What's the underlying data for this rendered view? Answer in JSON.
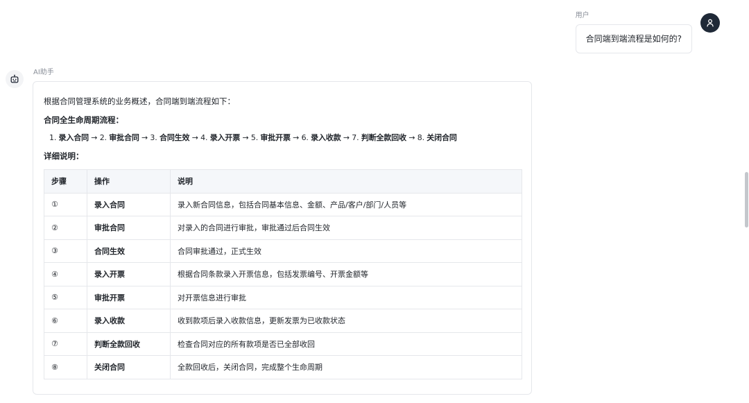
{
  "user": {
    "name": "用户",
    "message": "合同端到端流程是如何的?"
  },
  "assistant": {
    "name": "AI助手",
    "intro": "根据合同管理系统的业务概述，合同端到端流程如下：",
    "lifecycle_heading": "合同全生命周期流程：",
    "flow": {
      "prefix": "1. ",
      "steps": [
        {
          "label": "录入合同",
          "sep": " → 2. "
        },
        {
          "label": "审批合同",
          "sep": " → 3. "
        },
        {
          "label": "合同生效",
          "sep": " → 4. "
        },
        {
          "label": "录入开票",
          "sep": " → 5. "
        },
        {
          "label": "审批开票",
          "sep": " → 6. "
        },
        {
          "label": "录入收款",
          "sep": " → 7. "
        },
        {
          "label": "判断全款回收",
          "sep": " → 8. "
        },
        {
          "label": "关闭合同",
          "sep": ""
        }
      ]
    },
    "detail_heading": "详细说明：",
    "table": {
      "headers": [
        "步骤",
        "操作",
        "说明"
      ],
      "rows": [
        {
          "step": "①",
          "op": "录入合同",
          "desc": "录入新合同信息，包括合同基本信息、金额、产品/客户/部门/人员等"
        },
        {
          "step": "②",
          "op": "审批合同",
          "desc": "对录入的合同进行审批，审批通过后合同生效"
        },
        {
          "step": "③",
          "op": "合同生效",
          "desc": "合同审批通过，正式生效"
        },
        {
          "step": "④",
          "op": "录入开票",
          "desc": "根据合同条款录入开票信息，包括发票编号、开票金额等"
        },
        {
          "step": "⑤",
          "op": "审批开票",
          "desc": "对开票信息进行审批"
        },
        {
          "step": "⑥",
          "op": "录入收款",
          "desc": "收到款项后录入收款信息，更新发票为已收款状态"
        },
        {
          "step": "⑦",
          "op": "判断全款回收",
          "desc": "检查合同对应的所有款项是否已全部收回"
        },
        {
          "step": "⑧",
          "op": "关闭合同",
          "desc": "全款回收后，关闭合同，完成整个生命周期"
        }
      ]
    }
  },
  "icons": {
    "user_avatar": "user-icon",
    "assistant_avatar": "robot-icon"
  },
  "colors": {
    "avatar_dark": "#1f2937",
    "border": "#e5e7eb",
    "table_header_bg": "#f5f7fa",
    "muted_text": "#8a8f99"
  }
}
